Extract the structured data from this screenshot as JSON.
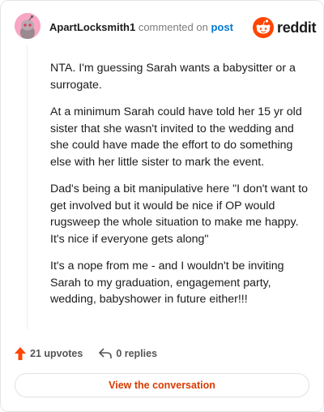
{
  "header": {
    "username": "ApartLocksmith1",
    "commented_on": "commented on",
    "post_link": "post",
    "brand": "reddit"
  },
  "comment": {
    "paragraphs": [
      "NTA. I'm guessing Sarah wants a babysitter or a surrogate.",
      "At a minimum Sarah could have told her 15 yr old sister that she wasn't invited to the wedding and she could have made the effort to do something else with her little sister to mark the event.",
      "Dad's being a bit manipulative here \"I don't want to get involved but it would be nice if OP would rugsweep the whole situation to make me happy. It's nice if everyone gets along\"",
      "It's a nope from me - and I wouldn't be inviting Sarah to my graduation, engagement party, wedding, babyshower in future either!!!"
    ]
  },
  "actions": {
    "upvotes": "21 upvotes",
    "replies": "0 replies"
  },
  "footer": {
    "view_button": "View the conversation"
  },
  "colors": {
    "brand_orange": "#ff4500",
    "link_blue": "#0079d3",
    "button_text": "#d93a00"
  },
  "icons": [
    "avatar-snoo",
    "reddit-logo-icon",
    "upvote-arrow-icon",
    "reply-arrow-icon"
  ]
}
